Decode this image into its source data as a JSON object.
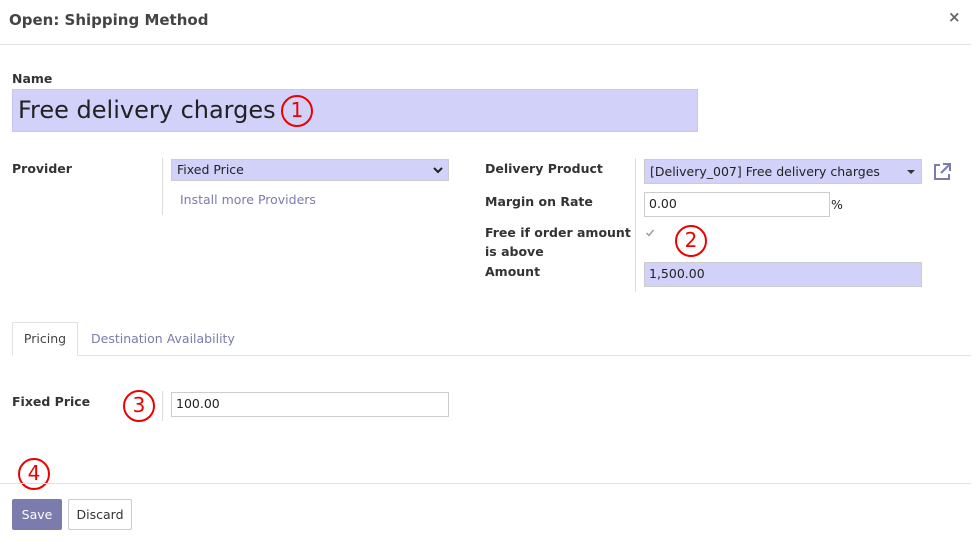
{
  "dialog": {
    "title": "Open: Shipping Method",
    "close_glyph": "×"
  },
  "form": {
    "name_label": "Name",
    "name_value": "Free delivery charges",
    "provider_label": "Provider",
    "provider_value": "Fixed Price",
    "install_link": "Install more Providers",
    "delivery_product_label": "Delivery Product",
    "delivery_product_value": "[Delivery_007] Free delivery charges",
    "margin_label": "Margin on Rate",
    "margin_value": "0.00",
    "margin_unit": "%",
    "free_label_line1": "Free if order amount",
    "free_label_line2": "is above",
    "free_checked": true,
    "amount_label": "Amount",
    "amount_value": "1,500.00"
  },
  "tabs": [
    {
      "label": "Pricing",
      "active": true
    },
    {
      "label": "Destination Availability",
      "active": false
    }
  ],
  "pricing": {
    "fixed_price_label": "Fixed Price",
    "fixed_price_value": "100.00"
  },
  "footer": {
    "save_label": "Save",
    "discard_label": "Discard"
  },
  "annotations": [
    "1",
    "2",
    "3",
    "4"
  ],
  "icons": {
    "external_link": "external-link-icon",
    "dropdown": "chevron-down-icon",
    "check": "checkmark-icon"
  },
  "colors": {
    "accent": "#7c7bad",
    "highlight": "#d1d1fa",
    "annotation": "#ee0000"
  }
}
